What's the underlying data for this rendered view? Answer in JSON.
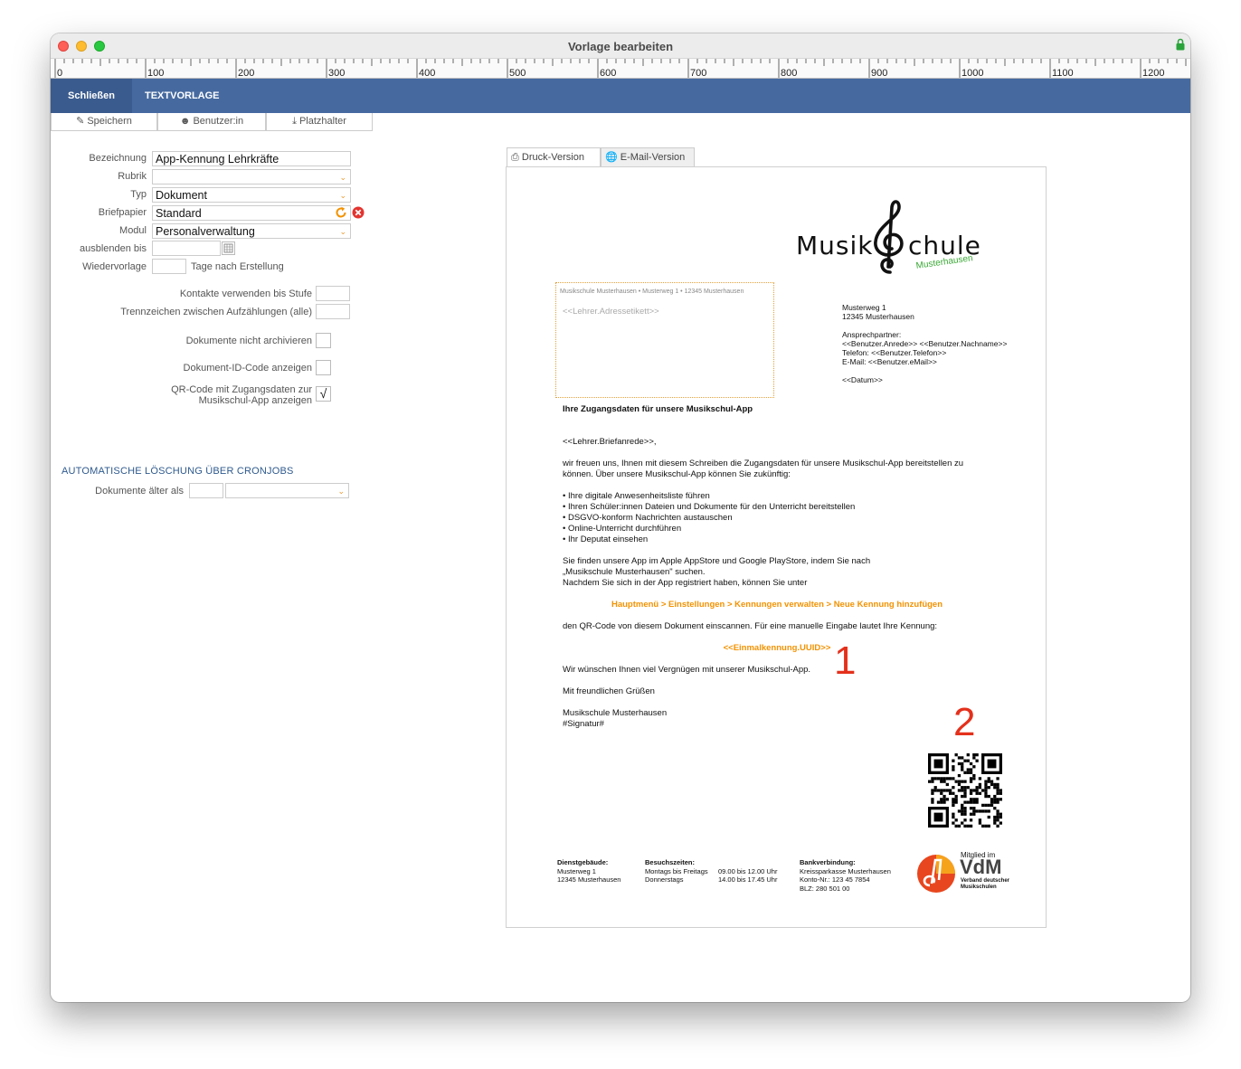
{
  "window": {
    "title": "Vorlage bearbeiten"
  },
  "ruler": {
    "labels": [
      "0",
      "100",
      "200",
      "300",
      "400",
      "500",
      "600",
      "700",
      "800",
      "900",
      "1000",
      "1100",
      "1200"
    ]
  },
  "menubar": {
    "close_label": "Schließen",
    "section_label": "TEXTVORLAGE"
  },
  "toolbar": {
    "save_label": "Speichern",
    "user_label": "Benutzer:in",
    "placeholder_label": "Platzhalter"
  },
  "form": {
    "bezeichnung": {
      "label": "Bezeichnung",
      "value": "App-Kennung Lehrkräfte"
    },
    "rubrik": {
      "label": "Rubrik",
      "value": ""
    },
    "typ": {
      "label": "Typ",
      "value": "Dokument"
    },
    "briefpapier": {
      "label": "Briefpapier",
      "value": "Standard"
    },
    "modul": {
      "label": "Modul",
      "value": "Personalverwaltung"
    },
    "ausblenden": {
      "label": "ausblenden bis",
      "value": ""
    },
    "wiedervorlage": {
      "label": "Wiedervorlage",
      "suffix": "Tage nach Erstellung",
      "value": ""
    },
    "kontakte": {
      "label": "Kontakte verwenden bis Stufe",
      "value": ""
    },
    "trennzeichen": {
      "label": "Trennzeichen zwischen Aufzählungen (alle)",
      "value": ""
    },
    "nicht_archivieren": {
      "label": "Dokumente nicht archivieren",
      "checked": false
    },
    "id_code": {
      "label": "Dokument-ID-Code anzeigen",
      "checked": false
    },
    "qr_code": {
      "label_line1": "QR-Code mit Zugangsdaten zur",
      "label_line2": "Musikschul-App anzeigen",
      "checked": true,
      "mark": "√"
    }
  },
  "cron": {
    "title": "AUTOMATISCHE LÖSCHUNG ÜBER CRONJOBS",
    "label": "Dokumente älter als",
    "value": "",
    "unit": ""
  },
  "preview_tabs": {
    "print": "Druck-Version",
    "email": "E-Mail-Version"
  },
  "letter": {
    "logo_text": "Musik",
    "logo_text2": "chule",
    "logo_sub": "Musterhausen",
    "sender_line": "Musikschule Musterhausen • Musterweg 1 • 12345 Musterhausen",
    "address_placeholder": "<<Lehrer.Adressetikett>>",
    "info": [
      "Musterweg 1",
      "12345 Musterhausen",
      "",
      "Ansprechpartner:",
      "<<Benutzer.Anrede>> <<Benutzer.Nachname>>",
      "Telefon: <<Benutzer.Telefon>>",
      "E-Mail: <<Benutzer.eMail>>",
      "",
      "<<Datum>>"
    ],
    "subject": "Ihre Zugangsdaten für unsere Musikschul-App",
    "salutation": "<<Lehrer.Briefanrede>>,",
    "intro": [
      "wir freuen uns, Ihnen mit diesem Schreiben die Zugangsdaten für unsere Musikschul-App bereitstellen zu",
      "können. Über unsere Musikschul-App können Sie zukünftig:"
    ],
    "bullets": [
      "• Ihre digitale Anwesenheitsliste führen",
      "• Ihren Schüler:innen Dateien und Dokumente für den Unterricht bereitstellen",
      "• DSGVO-konform Nachrichten austauschen",
      "• Online-Unterricht durchführen",
      "• Ihr Deputat einsehen"
    ],
    "find": [
      "Sie finden unsere App im Apple AppStore und Google PlayStore, indem Sie nach",
      "„Musikschule Musterhausen\" suchen.",
      "Nachdem Sie sich in der App registriert haben, können Sie unter"
    ],
    "menu_path": "Hauptmenü > Einstellungen > Kennungen verwalten > Neue Kennung hinzufügen",
    "qr_line": "den QR-Code von diesem Dokument einscannen. Für eine manuelle Eingabe lautet Ihre Kennung:",
    "uuid": "<<Einmalkennung.UUID>>",
    "wish": "Wir wünschen Ihnen viel Vergnügen mit unserer Musikschul-App.",
    "greeting": "Mit freundlichen Grüßen",
    "sign1": "Musikschule Musterhausen",
    "sign2": "#Signatur#",
    "annotation1": "1",
    "annotation2": "2"
  },
  "footer": {
    "col1": {
      "title": "Dienstgebäude:",
      "lines": [
        "Musterweg 1",
        "12345 Musterhausen"
      ]
    },
    "col2": {
      "title": "Besuchszeiten:",
      "lines": [
        "Montags bis Freitags",
        "Donnerstags"
      ],
      "times": [
        "09.00 bis 12.00 Uhr",
        "14.00 bis 17.45 Uhr"
      ]
    },
    "col3": {
      "title": "Bankverbindung:",
      "lines": [
        "Kreissparkasse Musterhausen",
        "Konto-Nr.: 123 45 7854",
        "BLZ: 280 501 00"
      ]
    },
    "vdm": {
      "top": "Mitglied im",
      "big": "VdM",
      "sub1": "Verband deutscher",
      "sub2": "Musikschulen"
    }
  },
  "colors": {
    "menubar": "#466aa0",
    "accent": "#f39200",
    "annotation": "#e4301b",
    "logo_green": "#3aa935"
  }
}
